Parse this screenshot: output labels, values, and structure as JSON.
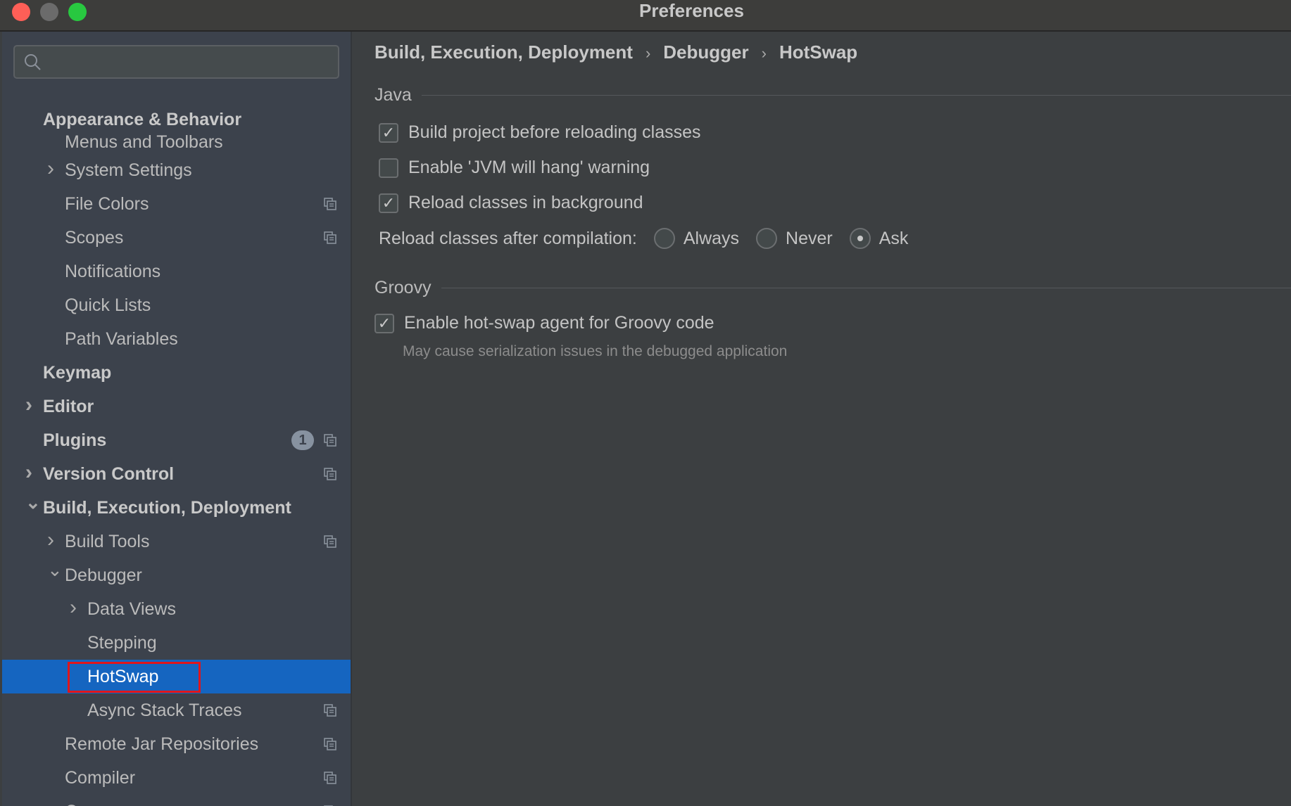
{
  "window": {
    "title": "Preferences",
    "lights": {
      "close": "#fe5f57",
      "minimize": "#6b6b6b",
      "zoom": "#28c840"
    }
  },
  "sidebar": {
    "search_placeholder": "",
    "items": [
      {
        "label": "Appearance & Behavior",
        "level": 0,
        "bold": true
      },
      {
        "label": "Menus and Toolbars",
        "level": 1
      },
      {
        "label": "System Settings",
        "level": 1,
        "arrow": "right"
      },
      {
        "label": "File Colors",
        "level": 1,
        "copy": true
      },
      {
        "label": "Scopes",
        "level": 1,
        "copy": true
      },
      {
        "label": "Notifications",
        "level": 1
      },
      {
        "label": "Quick Lists",
        "level": 1
      },
      {
        "label": "Path Variables",
        "level": 1
      },
      {
        "label": "Keymap",
        "level": 0,
        "bold": true
      },
      {
        "label": "Editor",
        "level": 0,
        "bold": true,
        "arrow": "right"
      },
      {
        "label": "Plugins",
        "level": 0,
        "bold": true,
        "badge": "1",
        "copy": true
      },
      {
        "label": "Version Control",
        "level": 0,
        "bold": true,
        "arrow": "right",
        "copy": true
      },
      {
        "label": "Build, Execution, Deployment",
        "level": 0,
        "bold": true,
        "arrow": "down"
      },
      {
        "label": "Build Tools",
        "level": 1,
        "arrow": "right",
        "copy": true
      },
      {
        "label": "Debugger",
        "level": 1,
        "arrow": "down"
      },
      {
        "label": "Data Views",
        "level": 2,
        "arrow": "right"
      },
      {
        "label": "Stepping",
        "level": 2
      },
      {
        "label": "HotSwap",
        "level": 2,
        "selected": true
      },
      {
        "label": "Async Stack Traces",
        "level": 2,
        "copy": true
      },
      {
        "label": "Remote Jar Repositories",
        "level": 1,
        "copy": true
      },
      {
        "label": "Compiler",
        "level": 1,
        "copy": true
      },
      {
        "label": "Coverage",
        "level": 1,
        "copy": true
      }
    ]
  },
  "breadcrumb": [
    "Build, Execution, Deployment",
    "Debugger",
    "HotSwap"
  ],
  "java": {
    "title": "Java",
    "options": [
      {
        "label": "Build project before reloading classes",
        "checked": true
      },
      {
        "label": "Enable 'JVM will hang' warning",
        "checked": false
      },
      {
        "label": "Reload classes in background",
        "checked": true
      }
    ],
    "reload_label": "Reload classes after compilation:",
    "reload_options": [
      "Always",
      "Never",
      "Ask"
    ],
    "reload_selected": "Ask"
  },
  "groovy": {
    "title": "Groovy",
    "option": {
      "label": "Enable hot-swap agent for Groovy code",
      "checked": true
    },
    "note": "May cause serialization issues in the debugged application"
  },
  "colors": {
    "selection": "#1565c0",
    "highlight_box": "#e0151b"
  }
}
